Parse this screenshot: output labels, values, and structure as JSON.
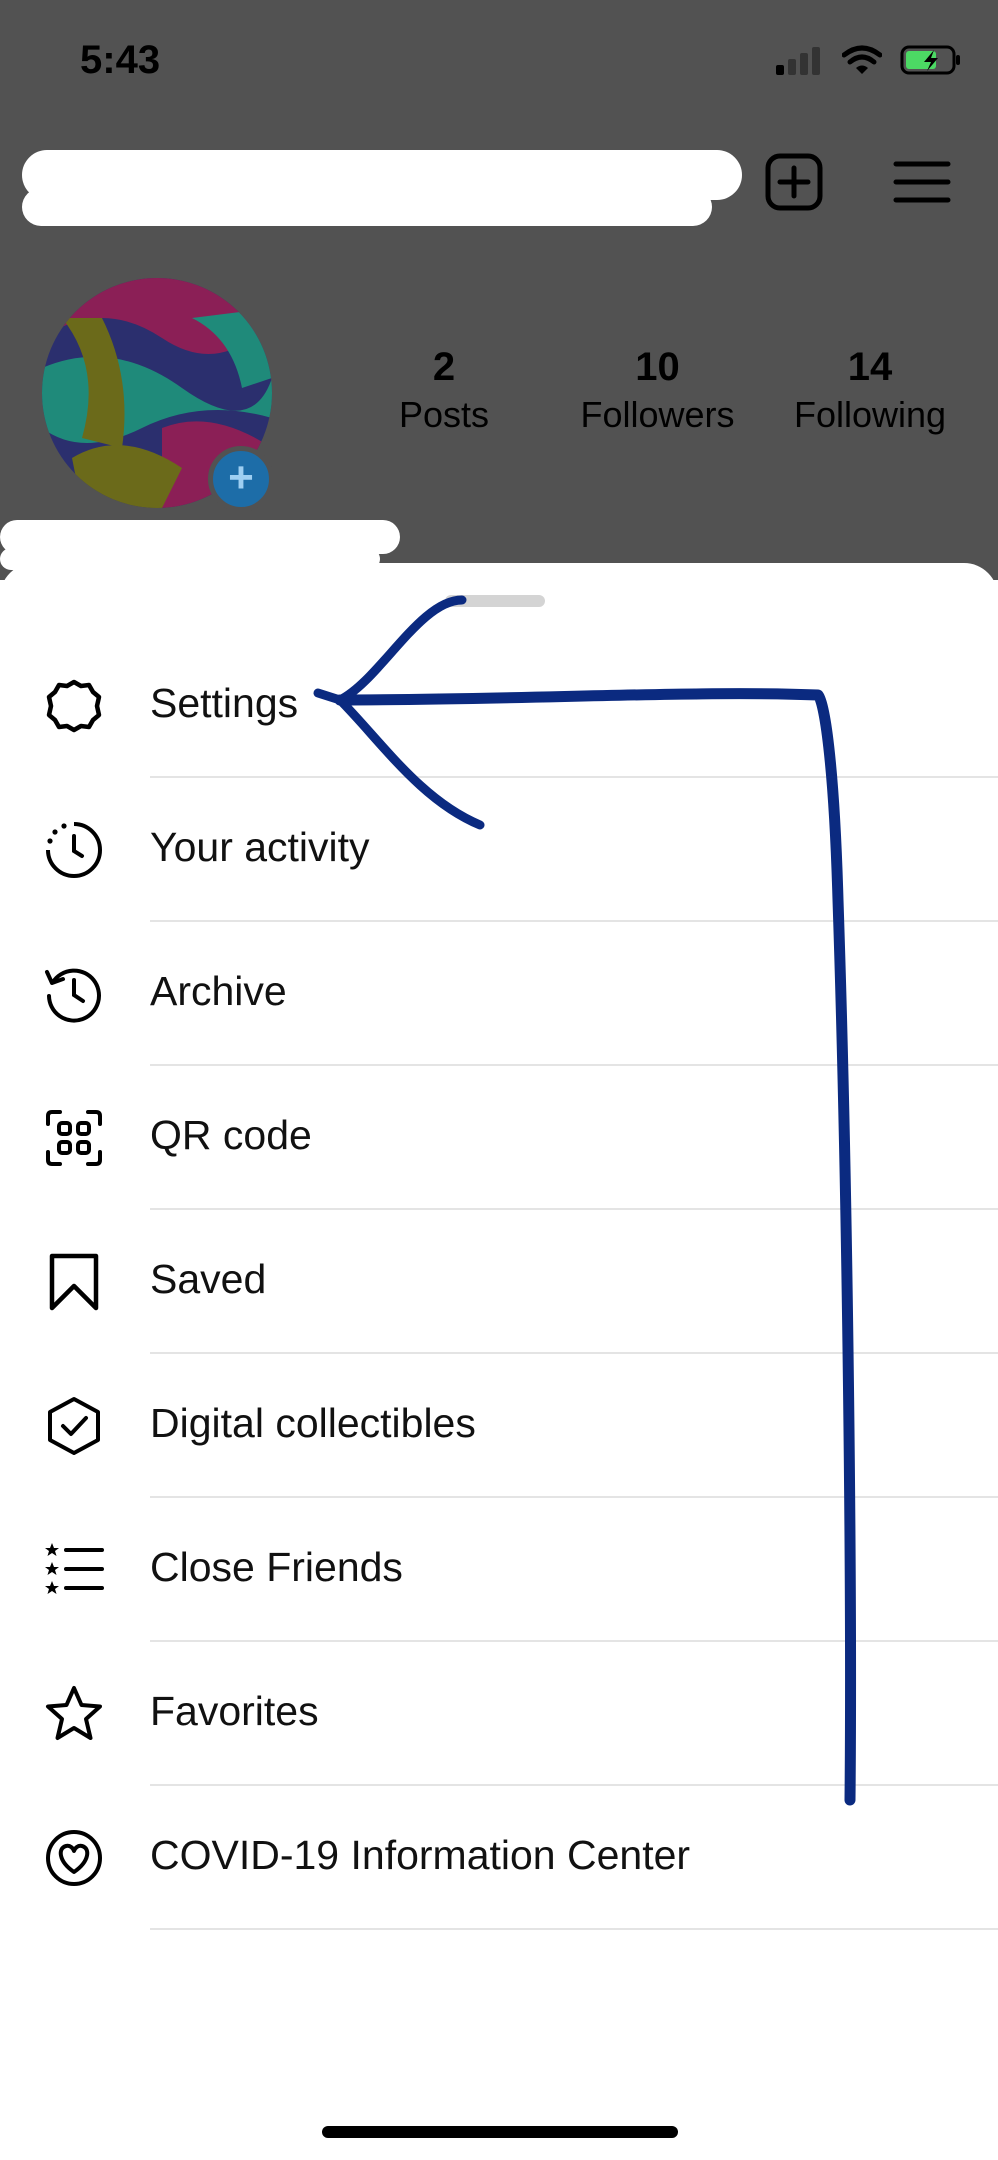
{
  "status_bar": {
    "time": "5:43"
  },
  "profile": {
    "stats": [
      {
        "value": "2",
        "label": "Posts"
      },
      {
        "value": "10",
        "label": "Followers"
      },
      {
        "value": "14",
        "label": "Following"
      }
    ]
  },
  "menu": {
    "items": [
      {
        "label": "Settings",
        "icon": "settings-icon"
      },
      {
        "label": "Your activity",
        "icon": "activity-icon"
      },
      {
        "label": "Archive",
        "icon": "archive-icon"
      },
      {
        "label": "QR code",
        "icon": "qr-code-icon"
      },
      {
        "label": "Saved",
        "icon": "bookmark-icon"
      },
      {
        "label": "Digital collectibles",
        "icon": "badge-check-icon"
      },
      {
        "label": "Close Friends",
        "icon": "close-friends-icon"
      },
      {
        "label": "Favorites",
        "icon": "star-icon"
      },
      {
        "label": "COVID-19 Information Center",
        "icon": "covid-heart-icon"
      }
    ]
  },
  "colors": {
    "annotation": "#0b2a80",
    "overlay": "#525252",
    "battery": "#4cd964"
  }
}
